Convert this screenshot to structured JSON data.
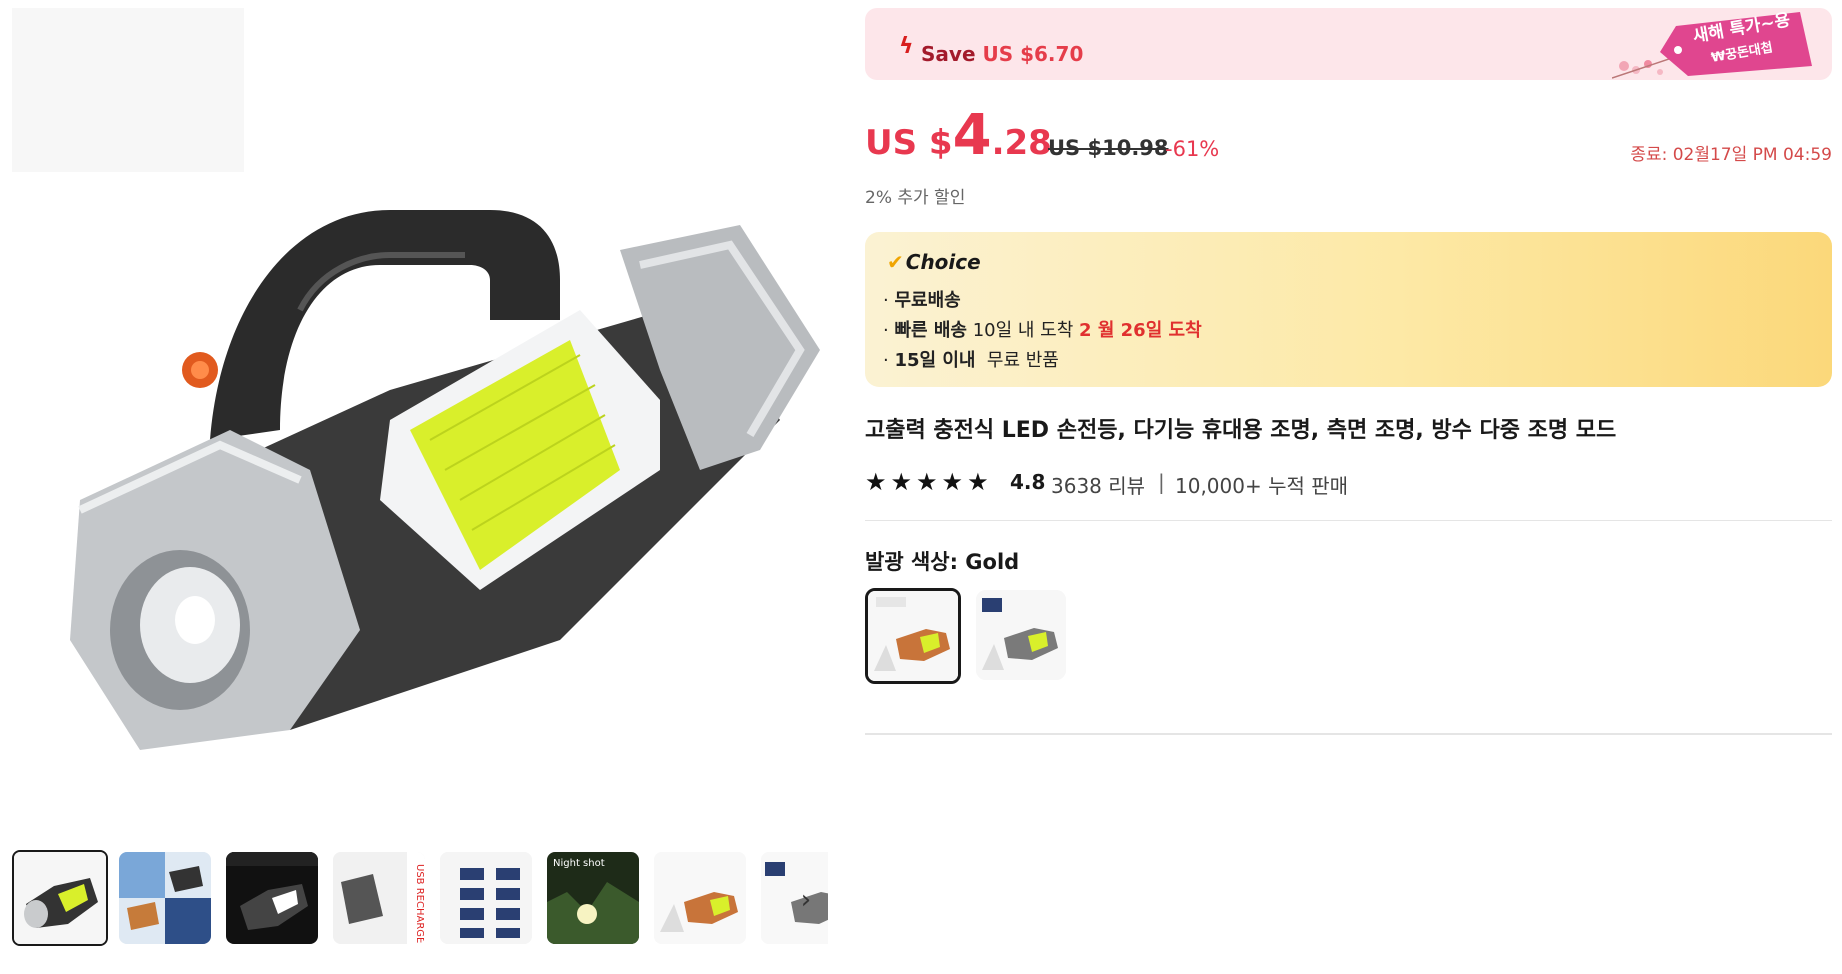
{
  "gallery": {
    "thumbnails": [
      {
        "icon": "flashlight-icon",
        "label": ""
      },
      {
        "icon": "flashlight-collage-icon",
        "label": ""
      },
      {
        "icon": "flashlight-dark-icon",
        "label": ""
      },
      {
        "icon": "usb-recharge-icon",
        "label": "USB RECHARGE"
      },
      {
        "icon": "light-modes-icon",
        "label": ""
      },
      {
        "icon": "night-shot-icon",
        "label": "Night shot"
      },
      {
        "icon": "flashlight-gold-icon",
        "label": ""
      },
      {
        "icon": "flashlight-silver-icon",
        "label": ""
      }
    ],
    "next_icon": "chevron-right-icon"
  },
  "promo": {
    "save_label": "Save",
    "save_amount": "US $6.70",
    "tag_line1": "새해 특가~용",
    "tag_line2": "₩꿍돈대첩",
    "accent": "#e8384f",
    "tag_color": "#e0468f"
  },
  "price": {
    "currency": "US $",
    "integer": "4",
    "decimal": ".28",
    "original": "US $10.98",
    "discount": "-61%",
    "end_time": "종료: 02월17일 PM 04:59",
    "extra_discount": "2% 추가 할인"
  },
  "choice": {
    "title": "Choice",
    "line1": "무료배송",
    "line2_bold": "빠른 배송",
    "line2_text": "10일 내 도착",
    "line2_red": "2 월 26일 도착",
    "line3_bold": "15일 이내",
    "line3_text": "무료 반품"
  },
  "product": {
    "title": "고출력 충전식 LED 손전등, 다기능 휴대용 조명, 측면 조명, 방수 다중 조명 모드",
    "stars": "★★★★★",
    "rating": "4.8",
    "reviews": "3638 리뷰",
    "separator": "|",
    "sold": "10,000+ 누적 판매",
    "color_label": "발광 색상: Gold",
    "variants": [
      "Gold",
      "Silver"
    ]
  }
}
